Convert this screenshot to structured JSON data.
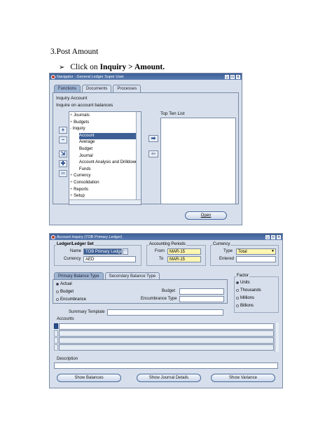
{
  "doc": {
    "heading": "3.Post Amount",
    "bullet_prefix": "Click on ",
    "bullet_bold": "Inquiry > Amount."
  },
  "navigator": {
    "title": "Navigator - General Ledger Super User",
    "tabs": [
      "Functions",
      "Documents",
      "Processes"
    ],
    "section_title": "Inquiry Account",
    "section_desc": "Inquire on account balances",
    "tree": [
      {
        "label": "Journals",
        "prefix": "+",
        "indent": 0
      },
      {
        "label": "Budgets",
        "prefix": "+",
        "indent": 0
      },
      {
        "label": "Inquiry",
        "prefix": "-",
        "indent": 0
      },
      {
        "label": "Account",
        "prefix": "",
        "indent": 1,
        "selected": true
      },
      {
        "label": "Average",
        "prefix": "",
        "indent": 1
      },
      {
        "label": "Budget",
        "prefix": "",
        "indent": 1
      },
      {
        "label": "Journal",
        "prefix": "",
        "indent": 1
      },
      {
        "label": "Account Analysis and Drilldown",
        "prefix": "",
        "indent": 1
      },
      {
        "label": "Funds",
        "prefix": "",
        "indent": 1
      },
      {
        "label": "Currency",
        "prefix": "+",
        "indent": 0
      },
      {
        "label": "Consolidation",
        "prefix": "+",
        "indent": 0
      },
      {
        "label": "Reports",
        "prefix": "+",
        "indent": 0
      },
      {
        "label": "Setup",
        "prefix": "+",
        "indent": 0
      }
    ],
    "top_ten_label": "Top Ten List",
    "open_button": "Open"
  },
  "inquiry": {
    "title": "Account Inquiry (TOB Primary Ledger)",
    "ledger_group": "Ledger/Ledger Set",
    "name_label": "Name",
    "name_value": "TOB Primary Ledger",
    "currency_label": "Currency",
    "currency_value": "AED",
    "periods_group": "Accounting Periods",
    "from_label": "From",
    "from_value": "MAR-15",
    "to_label": "To",
    "to_value": "MAR-15",
    "currency_group": "Currency",
    "type_label": "Type",
    "type_value": "Total",
    "entered_label": "Entered",
    "balance_tabs": [
      "Primary Balance Type",
      "Secondary Balance Type"
    ],
    "balance_radios": [
      "Actual",
      "Budget",
      "Encumbrance"
    ],
    "budget_label": "Budget",
    "encumbrance_label": "Encumbrance Type",
    "factor_group": "Factor",
    "factor_radios": [
      "Units",
      "Thousands",
      "Millions",
      "Billions"
    ],
    "summary_template_label": "Summary Template",
    "accounts_label": "Accounts",
    "description_label": "Description",
    "buttons": [
      "Show Balances",
      "Show Journal Details",
      "Show Variance"
    ]
  }
}
